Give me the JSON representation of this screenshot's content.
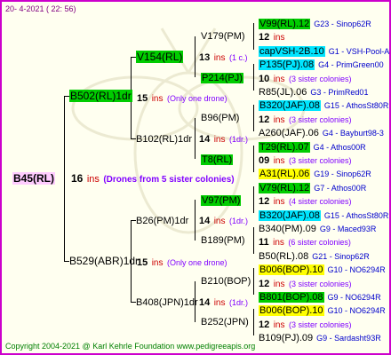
{
  "header": {
    "date": "20- 4-2021 ( 22: 56)"
  },
  "footer": {
    "copyright": "Copyright 2004-2021 @ Karl Kehrle Foundation   www.pedigreeapis.org"
  },
  "root": {
    "name": "B45(RL)",
    "num": "16",
    "ins": "ins",
    "note": "(Drones from 5 sister colonies)"
  },
  "gen1": [
    {
      "name": "B502(RL)1dr",
      "num": "15",
      "ins": "ins",
      "note": "(Only one drone)"
    },
    {
      "name": "B529(ABR)1dr",
      "num": "15",
      "ins": "ins",
      "note": "(Only one drone)"
    }
  ],
  "gen2": [
    {
      "name": "V154(RL)",
      "num": "15",
      "ins": "ins",
      "note": "(Only one drone)"
    },
    {
      "name": "B102(RL)1dr",
      "num": "14",
      "ins": "ins",
      "note": "(1dr.)"
    },
    {
      "name": "B26(PM)1dr",
      "num": "14",
      "ins": "ins",
      "note": "(1dr.)"
    },
    {
      "name": "B408(JPN)1dr",
      "num": "14",
      "ins": "ins",
      "note": "(1dr.)"
    }
  ],
  "gen3": [
    {
      "name": "V179(PM)",
      "num": "13",
      "ins": "ins",
      "note": "(1 c.)"
    },
    {
      "name": "P214(PJ)"
    },
    {
      "name": "B96(PM)",
      "num": "14",
      "ins": "ins",
      "note": "(1dr.)"
    },
    {
      "name": "T8(RL)"
    },
    {
      "name": "V97(PM)",
      "num": "14",
      "ins": "ins",
      "note": "(1dr.)"
    },
    {
      "name": "B189(PM)"
    },
    {
      "name": "B210(BOP)",
      "num": "14",
      "ins": "ins",
      "note": "(1dr.)"
    },
    {
      "name": "B252(JPN)"
    }
  ],
  "gen4": [
    {
      "name": "V99(RL).12",
      "info": "G23 - Sinop62R"
    },
    {
      "num": "12",
      "ins": "ins",
      "note": ""
    },
    {
      "name": "capVSH-2B.10",
      "info": "G1 - VSH-Pool-AR"
    },
    {
      "name": "P135(PJ).08",
      "info": "G4 - PrimGreen00"
    },
    {
      "num": "10",
      "ins": "ins",
      "note": "(3 sister colonies)"
    },
    {
      "name": "R85(JL).06",
      "info": "G3 - PrimRed01"
    },
    {
      "name": "B320(JAF).08",
      "info": "G15 - AthosSt80R"
    },
    {
      "num": "12",
      "ins": "ins",
      "note": "(3 sister colonies)"
    },
    {
      "name": "A260(JAF).06",
      "info": "G4 - Bayburt98-3"
    },
    {
      "name": "T29(RL).07",
      "info": "G4 - Athos00R"
    },
    {
      "num": "09",
      "ins": "ins",
      "note": "(3 sister colonies)"
    },
    {
      "name": "A31(RL).06",
      "info": "G19 - Sinop62R"
    },
    {
      "name": "V79(RL).12",
      "info": "G7 - Athos00R"
    },
    {
      "num": "12",
      "ins": "ins",
      "note": "(4 sister colonies)"
    },
    {
      "name": "B320(JAF).08",
      "info": "G15 - AthosSt80R"
    },
    {
      "name": "B340(PM).09",
      "info": "G9 - Maced93R"
    },
    {
      "num": "11",
      "ins": "ins",
      "note": "(6 sister colonies)"
    },
    {
      "name": "B50(RL).08",
      "info": "G21 - Sinop62R"
    },
    {
      "name": "B006(BOP).10",
      "info": "G10 - NO6294R"
    },
    {
      "num": "12",
      "ins": "ins",
      "note": "(3 sister colonies)"
    },
    {
      "name": "B801(BOP).08",
      "info": "G9 - NO6294R"
    },
    {
      "name": "B006(BOP).10",
      "info": "G10 - NO6294R"
    },
    {
      "num": "12",
      "ins": "ins",
      "note": "(3 sister colonies)"
    },
    {
      "name": "B109(PJ).09",
      "info": "G9 - Sardasht93R"
    }
  ]
}
